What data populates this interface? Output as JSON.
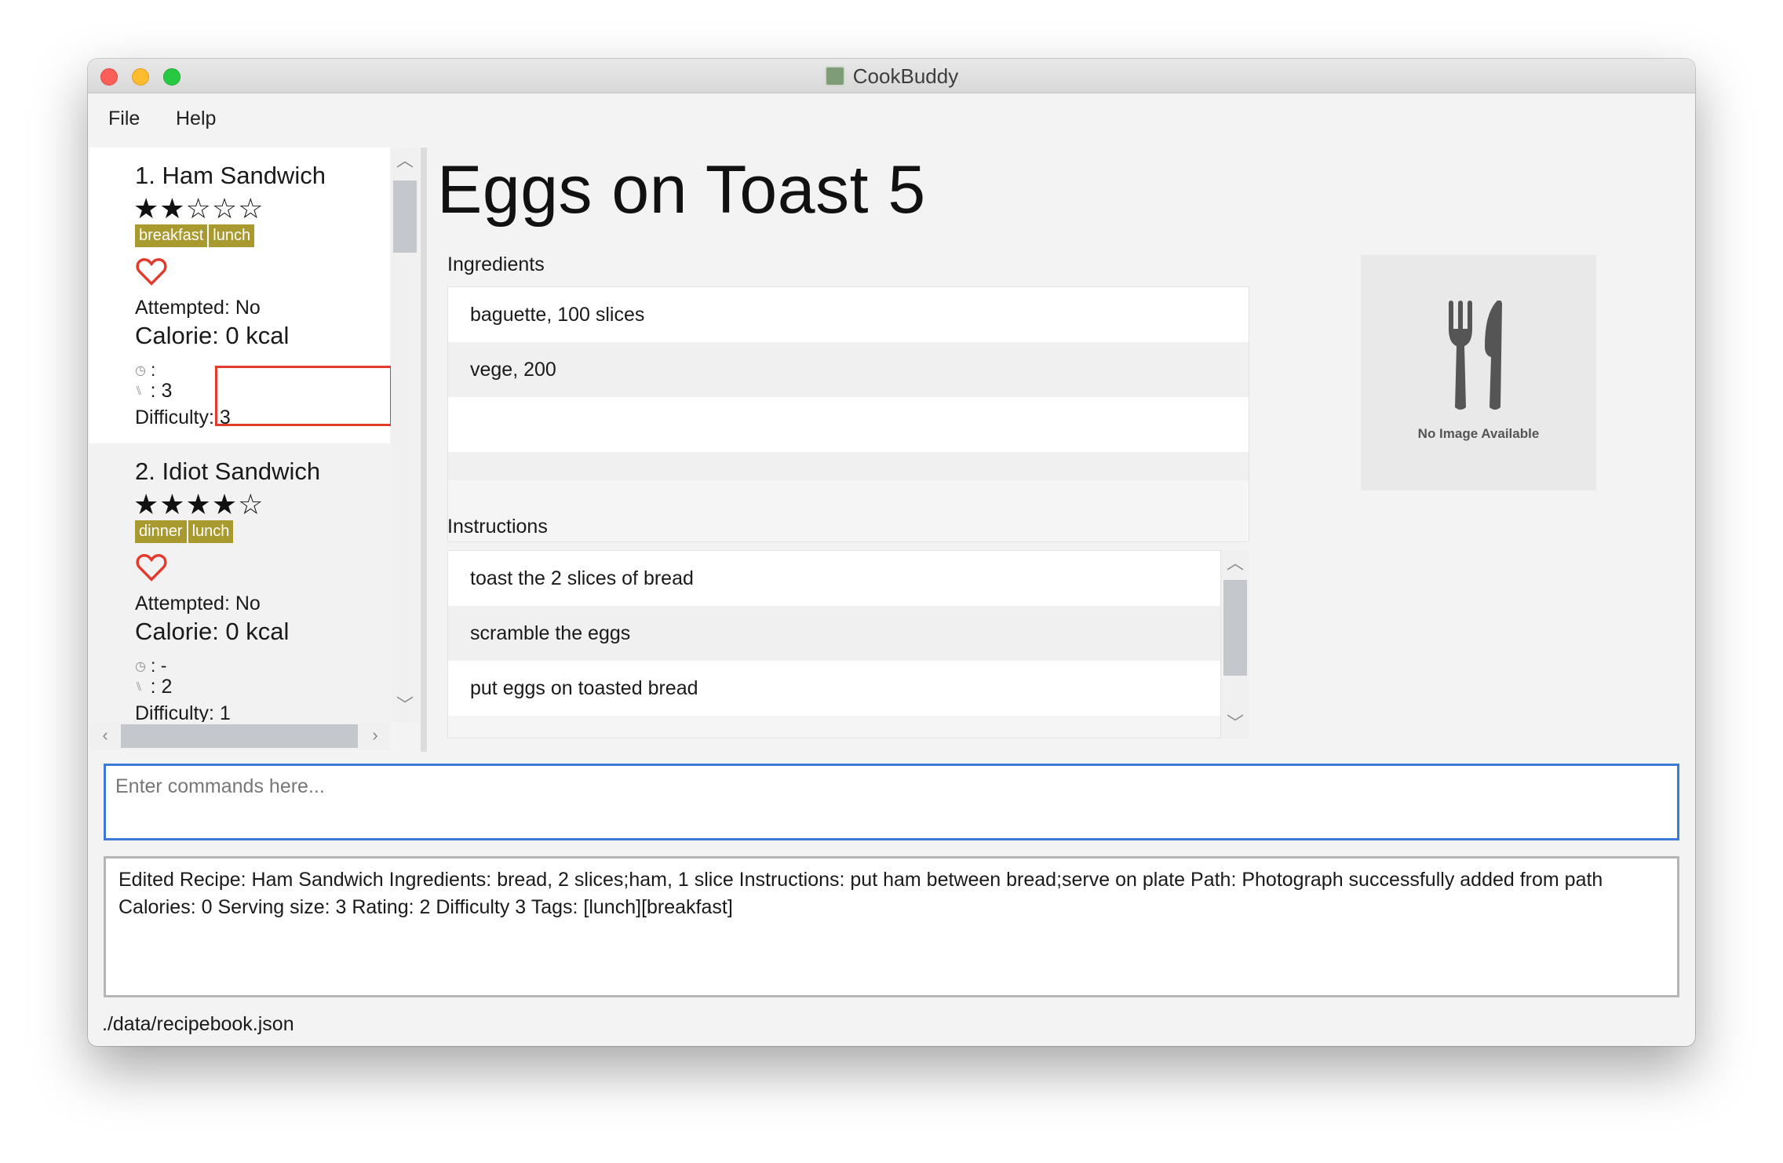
{
  "window": {
    "title": "CookBuddy"
  },
  "menu": {
    "file": "File",
    "help": "Help"
  },
  "recipes": [
    {
      "name": "1.  Ham Sandwich",
      "stars": "★★☆☆☆",
      "rating": 2,
      "tags": [
        "breakfast",
        "lunch"
      ],
      "attempted": "Attempted: No",
      "calorie": "Calorie: 0 kcal",
      "time": ": ",
      "serving": ": 3",
      "difficulty": "Difficulty: 3"
    },
    {
      "name": "2.  Idiot Sandwich",
      "stars": "★★★★☆",
      "rating": 4,
      "tags": [
        "dinner",
        "lunch"
      ],
      "attempted": "Attempted: No",
      "calorie": "Calorie: 0 kcal",
      "time": ": -",
      "serving": ": 2",
      "difficulty": "Difficulty: 1"
    }
  ],
  "detail": {
    "title": "Eggs on Toast 5",
    "ingredients_label": "Ingredients",
    "ingredients": [
      "baguette, 100 slices",
      "vege, 200"
    ],
    "instructions_label": "Instructions",
    "instructions": [
      "toast the 2 slices of bread",
      "scramble the eggs",
      "put eggs on toasted bread"
    ],
    "no_image_text": "No Image Available"
  },
  "command": {
    "placeholder": "Enter commands here...",
    "value": ""
  },
  "result": {
    "text": "Edited Recipe: Ham Sandwich Ingredients: bread, 2 slices;ham, 1 slice Instructions: put ham between bread;serve on plate Path: Photograph successfully added from path Calories: 0 Serving size: 3 Rating: 2 Difficulty 3 Tags: [lunch][breakfast]"
  },
  "status": {
    "path": "./data/recipebook.json"
  },
  "icons": {
    "heart": "heart-icon",
    "clock": "clock-icon",
    "utensils": "utensils-icon",
    "no_image": "fork-knife-icon"
  },
  "colors": {
    "tag_bg": "#a89a2e",
    "heart": "#e23a2d",
    "command_border": "#3d7ad6",
    "highlight": "#e23a2d"
  }
}
